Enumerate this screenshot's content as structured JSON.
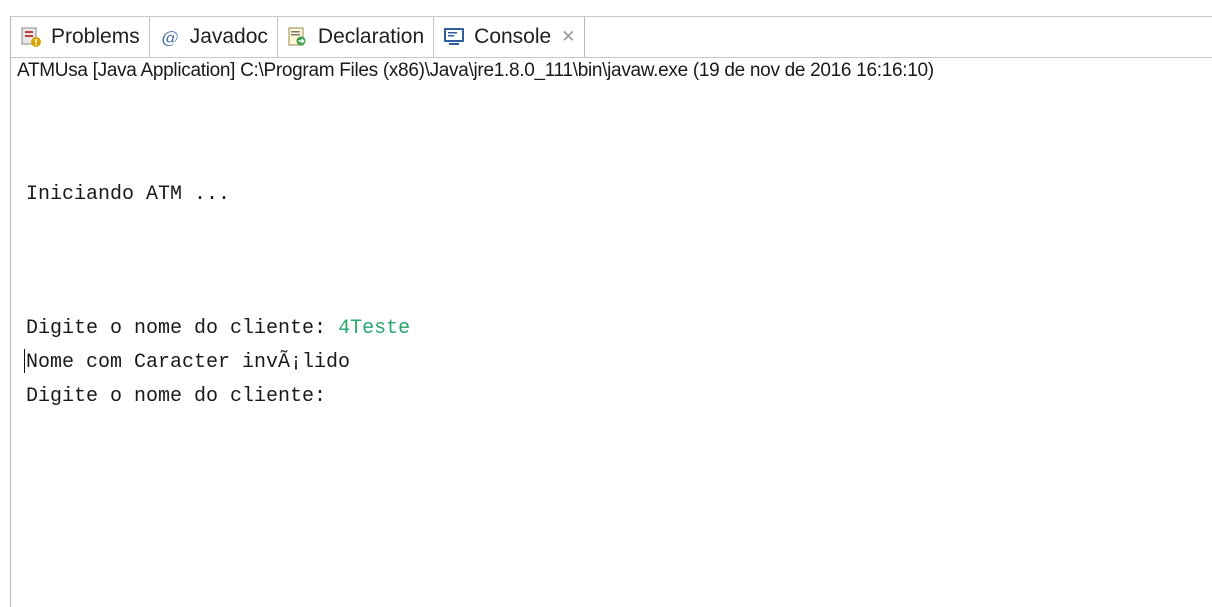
{
  "tabs": [
    {
      "label": "Problems",
      "icon": "problems-icon",
      "active": false
    },
    {
      "label": "Javadoc",
      "icon": "javadoc-icon",
      "active": false
    },
    {
      "label": "Declaration",
      "icon": "declaration-icon",
      "active": false
    },
    {
      "label": "Console",
      "icon": "console-icon",
      "active": true,
      "close_glyph": "✕"
    }
  ],
  "run_info": "ATMUsa [Java Application] C:\\Program Files (x86)\\Java\\jre1.8.0_111\\bin\\javaw.exe (19 de nov de 2016 16:16:10)",
  "console": {
    "line1": "Iniciando ATM ...",
    "line2_prompt": "Digite o nome do cliente: ",
    "line2_input": "4Teste",
    "line3": "Nome com Caracter invÃ¡lido",
    "line4": "Digite o nome do cliente:"
  },
  "colors": {
    "input_echo": "#2aa66c"
  }
}
